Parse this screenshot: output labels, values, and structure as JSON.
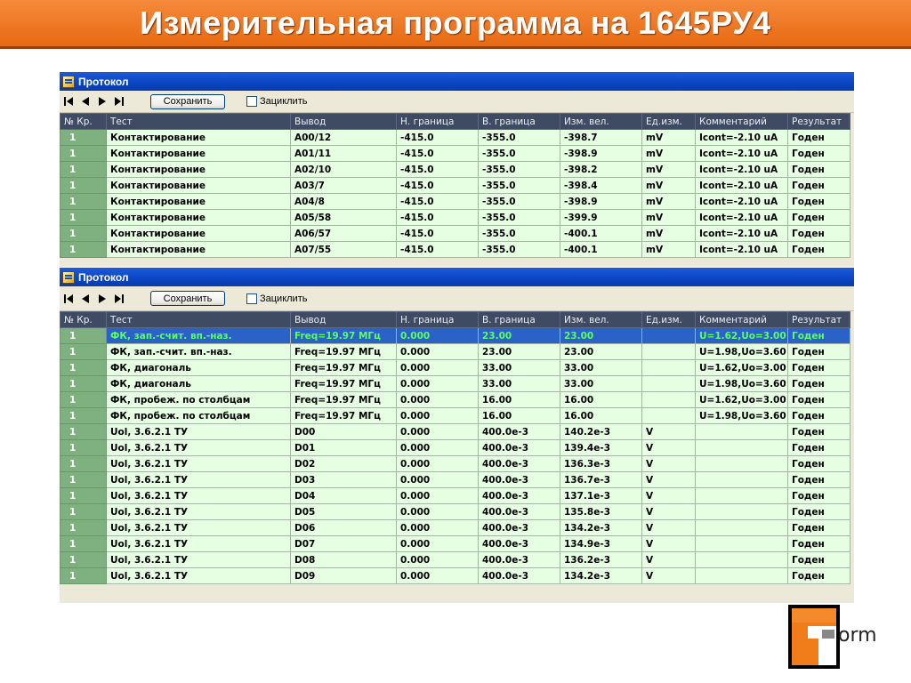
{
  "slide": {
    "title": "Измерительная программа на 1645РУ4"
  },
  "window1": {
    "title": "Протокол",
    "toolbar": {
      "save_label": "Сохранить",
      "loop_label": "Зациклить"
    },
    "columns": [
      "№ Кр.",
      "Тест",
      "Вывод",
      "Н. граница",
      "В. граница",
      "Изм. вел.",
      "Ед.изм.",
      "Комментарий",
      "Результат"
    ],
    "rows": [
      [
        "1",
        "Контактирование",
        "A00/12",
        "-415.0",
        "-355.0",
        "-398.7",
        "mV",
        "Icont=-2.10 uA",
        "Годен"
      ],
      [
        "1",
        "Контактирование",
        "A01/11",
        "-415.0",
        "-355.0",
        "-398.9",
        "mV",
        "Icont=-2.10 uA",
        "Годен"
      ],
      [
        "1",
        "Контактирование",
        "A02/10",
        "-415.0",
        "-355.0",
        "-398.2",
        "mV",
        "Icont=-2.10 uA",
        "Годен"
      ],
      [
        "1",
        "Контактирование",
        "A03/7",
        "-415.0",
        "-355.0",
        "-398.4",
        "mV",
        "Icont=-2.10 uA",
        "Годен"
      ],
      [
        "1",
        "Контактирование",
        "A04/8",
        "-415.0",
        "-355.0",
        "-398.9",
        "mV",
        "Icont=-2.10 uA",
        "Годен"
      ],
      [
        "1",
        "Контактирование",
        "A05/58",
        "-415.0",
        "-355.0",
        "-399.9",
        "mV",
        "Icont=-2.10 uA",
        "Годен"
      ],
      [
        "1",
        "Контактирование",
        "A06/57",
        "-415.0",
        "-355.0",
        "-400.1",
        "mV",
        "Icont=-2.10 uA",
        "Годен"
      ],
      [
        "1",
        "Контактирование",
        "A07/55",
        "-415.0",
        "-355.0",
        "-400.1",
        "mV",
        "Icont=-2.10 uA",
        "Годен"
      ]
    ]
  },
  "window2": {
    "title": "Протокол",
    "toolbar": {
      "save_label": "Сохранить",
      "loop_label": "Зациклить"
    },
    "columns": [
      "№ Кр.",
      "Тест",
      "Вывод",
      "Н. граница",
      "В. граница",
      "Изм. вел.",
      "Ед.изм.",
      "Комментарий",
      "Результат"
    ],
    "selected_row": 0,
    "rows": [
      [
        "1",
        "ФК, зап.-счит. вп.-наз.",
        "Freq=19.97 МГц",
        "0.000",
        "23.00",
        "23.00",
        "",
        "U=1.62,Uo=3.00",
        "Годен"
      ],
      [
        "1",
        "ФК, зап.-счит. вп.-наз.",
        "Freq=19.97 МГц",
        "0.000",
        "23.00",
        "23.00",
        "",
        "U=1.98,Uo=3.60",
        "Годен"
      ],
      [
        "1",
        "ФК, диагональ",
        "Freq=19.97 МГц",
        "0.000",
        "33.00",
        "33.00",
        "",
        "U=1.62,Uo=3.00",
        "Годен"
      ],
      [
        "1",
        "ФК, диагональ",
        "Freq=19.97 МГц",
        "0.000",
        "33.00",
        "33.00",
        "",
        "U=1.98,Uo=3.60",
        "Годен"
      ],
      [
        "1",
        "ФК, пробеж. по столбцам",
        "Freq=19.97 МГц",
        "0.000",
        "16.00",
        "16.00",
        "",
        "U=1.62,Uo=3.00",
        "Годен"
      ],
      [
        "1",
        "ФК, пробеж. по столбцам",
        "Freq=19.97 МГц",
        "0.000",
        "16.00",
        "16.00",
        "",
        "U=1.98,Uo=3.60",
        "Годен"
      ],
      [
        "1",
        "Uol, 3.6.2.1 ТУ",
        "D00",
        "0.000",
        "400.0e-3",
        "140.2e-3",
        "V",
        "",
        "Годен"
      ],
      [
        "1",
        "Uol, 3.6.2.1 ТУ",
        "D01",
        "0.000",
        "400.0e-3",
        "139.4e-3",
        "V",
        "",
        "Годен"
      ],
      [
        "1",
        "Uol, 3.6.2.1 ТУ",
        "D02",
        "0.000",
        "400.0e-3",
        "136.3e-3",
        "V",
        "",
        "Годен"
      ],
      [
        "1",
        "Uol, 3.6.2.1 ТУ",
        "D03",
        "0.000",
        "400.0e-3",
        "136.7e-3",
        "V",
        "",
        "Годен"
      ],
      [
        "1",
        "Uol, 3.6.2.1 ТУ",
        "D04",
        "0.000",
        "400.0e-3",
        "137.1e-3",
        "V",
        "",
        "Годен"
      ],
      [
        "1",
        "Uol, 3.6.2.1 ТУ",
        "D05",
        "0.000",
        "400.0e-3",
        "135.8e-3",
        "V",
        "",
        "Годен"
      ],
      [
        "1",
        "Uol, 3.6.2.1 ТУ",
        "D06",
        "0.000",
        "400.0e-3",
        "134.2e-3",
        "V",
        "",
        "Годен"
      ],
      [
        "1",
        "Uol, 3.6.2.1 ТУ",
        "D07",
        "0.000",
        "400.0e-3",
        "134.9e-3",
        "V",
        "",
        "Годен"
      ],
      [
        "1",
        "Uol, 3.6.2.1 ТУ",
        "D08",
        "0.000",
        "400.0e-3",
        "136.2e-3",
        "V",
        "",
        "Годен"
      ],
      [
        "1",
        "Uol, 3.6.2.1 ТУ",
        "D09",
        "0.000",
        "400.0e-3",
        "134.2e-3",
        "V",
        "",
        "Годен"
      ]
    ]
  },
  "icons": [
    "first-record-icon",
    "prev-record-icon",
    "next-record-icon",
    "last-record-icon",
    "protocol-app-icon",
    "checkbox-icon"
  ],
  "logo": {
    "text": "orm"
  },
  "colors": {
    "title_bar": "#e8701c",
    "window_caption": "#0a45c4",
    "grid_header": "#3e4b62",
    "row_bg": "#e6ffe2",
    "selected_row": "#2a62c8"
  }
}
